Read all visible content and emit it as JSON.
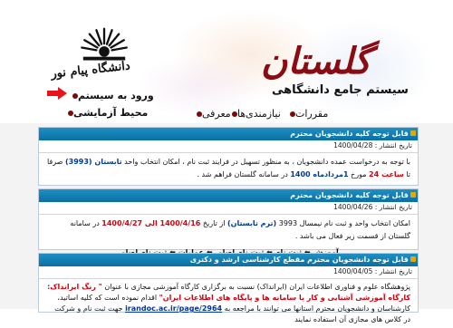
{
  "header": {
    "university_name": "دانشگاه پیام نور",
    "brand_title": "گلستان",
    "brand_subtitle": "سیستم جامع دانشگاهی",
    "menu": [
      {
        "label": "معرفی"
      },
      {
        "label": "نیازمندی‌ها"
      },
      {
        "label": "مقررات"
      }
    ],
    "login_link": "ورود به سیستم",
    "test_env_link": "محیط آزمایشی"
  },
  "announcements": [
    {
      "title": "- قابل توجه کلیه دانشجویان محترم",
      "date_label": "تاریخ انتشار :",
      "date": "1400/04/28",
      "body": [
        {
          "text": "با توجه به درخواست عمده دانشجویان ، به منظور تسهیل در فرایند ثبت نام ، امکان انتخاب واحد "
        },
        {
          "text": "تابستان (3993)",
          "cls": "blue"
        },
        {
          "text": " صرفا تا "
        },
        {
          "text": "ساعت 24",
          "cls": "red"
        },
        {
          "text": " مورخ "
        },
        {
          "text": "1مردادماه 1400",
          "cls": "blue"
        },
        {
          "text": " در سامانه گلستان فراهم شد ."
        }
      ]
    },
    {
      "title": "- قابل توجه کلیه دانشجویان محترم",
      "date_label": "تاریخ انتشار :",
      "date": "1400/04/26",
      "body_line1_a": "امکان انتخاب واحد و ثبت نام نیمسال 3993 ",
      "body_line1_b": "(ترم تابستان)",
      "body_line1_c": " از تاریخ ",
      "body_line1_d": "1400/4/16 الی 1400/4/27",
      "body_line1_e": " در سامانه گلستان از قسمت زیر فعال می باشد .",
      "path": [
        "آموزش",
        "ثبت نام",
        "ثبت نام اصلی",
        "عملیات",
        "ثبت نام اصلی"
      ]
    },
    {
      "title": "- قابل توجه دانشجویان محترم مقطع کارشناسی ارشد و دکتری",
      "date_label": "تاریخ انتشار :",
      "date": "1400/04/05",
      "body_a": "پژوهشگاه علوم و فناوری اطلاعات ایران (ایرانداک) نسبت به برگزاری کارگاه آموزشی مجازی با عنوان ",
      "body_b": "\" رنگ ایرانداک: کارگاه آموزشی آشنایی و کار با سامانه ها و پایگاه های اطلاعات ایران\"",
      "body_c": " اقدام نموده است که کلیه اساتید، کارشناسان و دانشجویان محترم استانها می توانند با مراجعه به",
      "url": "irandoc.ac.ir/page/2964",
      "body_d": " جهت ثبت نام و شرکت در کلاس های مجازی آن استفاده نمایند"
    }
  ]
}
